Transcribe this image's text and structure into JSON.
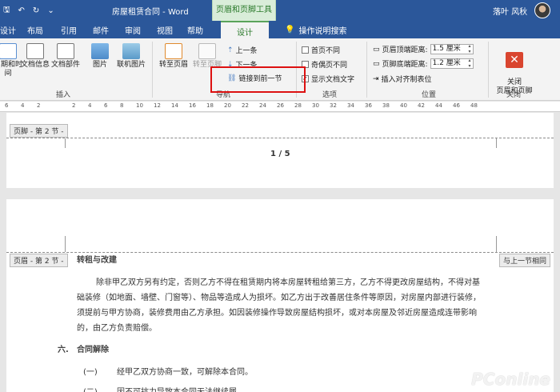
{
  "window": {
    "title": "房屋租赁合同 - Word",
    "context_tab_header": "页眉和页脚工具",
    "user": "落叶 风秋"
  },
  "tabs": [
    {
      "label": "设计",
      "active": false
    },
    {
      "label": "布局"
    },
    {
      "label": "引用"
    },
    {
      "label": "邮件"
    },
    {
      "label": "审阅"
    },
    {
      "label": "视图"
    },
    {
      "label": "帮助"
    },
    {
      "label": "设计",
      "active": true
    }
  ],
  "tell_me": "操作说明搜索",
  "ribbon": {
    "insert_group": {
      "label": "插入",
      "buttons": [
        "日期和时间",
        "文档信息",
        "文档部件",
        "图片",
        "联机图片"
      ]
    },
    "nav_group": {
      "label": "导航",
      "goto_header": "转至页眉",
      "goto_footer": "转至页脚",
      "prev": "上一条",
      "next": "下一条",
      "link_prev": "链接到前一节"
    },
    "options_group": {
      "label": "选项",
      "first_page": "首页不同",
      "odd_even": "奇偶页不同",
      "show_text": "显示文档文字"
    },
    "position_group": {
      "label": "位置",
      "header_top": "页眉顶端距离:",
      "header_top_val": "1.5 厘米",
      "footer_bottom": "页脚底端距离:",
      "footer_bottom_val": "1.2 厘米",
      "insert_align_tab": "插入对齐制表位"
    },
    "close_group": {
      "label": "关闭",
      "close_btn": "关闭\n页眉和页脚"
    }
  },
  "ruler_ticks": [
    "6",
    "4",
    "2",
    "2",
    "4",
    "6",
    "8",
    "10",
    "12",
    "14",
    "16",
    "18",
    "20",
    "22",
    "24",
    "26",
    "28",
    "30",
    "32",
    "34",
    "36",
    "38",
    "40",
    "42",
    "44",
    "46",
    "48"
  ],
  "document": {
    "footer_tag": "页脚 - 第 2 节 -",
    "page_number": "1 / 5",
    "header_tag": "页眉 - 第 2 节 -",
    "same_as_prev": "与上一节相同",
    "section_title": "转租与改建",
    "paragraph": "除非甲乙双方另有约定，否则乙方不得在租赁期内将本房屋转租给第三方，乙方不得更改房屋结构，不得对基础装修（如地面、墙壁、门窗等）、物品等造成人为损坏。如乙方出于改善居住条件等原因，对房屋内部进行装修，须提前与甲方协商，装修费用由乙方承担。如因装修操作导致房屋结构损坏，或对本房屋及邻近房屋造成连带影响的，由乙方负责赔偿。",
    "para_lines": [
      "除非甲乙双方另有约定，否则乙方不得在租赁期内将本房屋转租给第三方，乙方不得更改房屋结构，不得对基",
      "础装修（如地面、墙壁、门窗等）、物品等造成人为损坏。如乙方出于改善居住条件等原因，对房屋内部进行装修，",
      "须提前与甲方协商，装修费用由乙方承担。如因装修操作导致房屋结构损坏，或对本房屋及邻近房屋造成连带影响",
      "的，由乙方负责赔偿。"
    ],
    "section6_num": "六.",
    "section6_title": "合同解除",
    "item1_num": "(一)",
    "item1_text": "经甲乙双方协商一致，可解除本合同。",
    "item2_num": "(二)",
    "item2_text": "因不可抗力导致本合同无法继续履"
  },
  "watermark": "PConline",
  "colors": {
    "word_blue": "#2b579a",
    "context_green": "#5aa35a",
    "highlight_red": "#dd1111"
  }
}
